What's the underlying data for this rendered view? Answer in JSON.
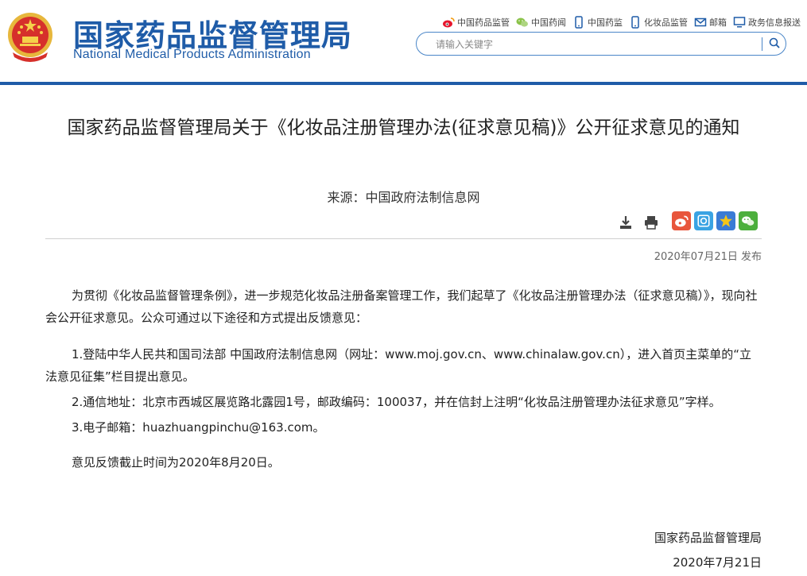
{
  "header": {
    "title_cn": "国家药品监督管理局",
    "title_en": "National Medical Products Administration",
    "emblem_icon": "national-emblem-icon",
    "links": [
      {
        "label": "中国药品监管",
        "icon": "weibo-icon"
      },
      {
        "label": "中国药闻",
        "icon": "wechat-icon"
      },
      {
        "label": "中国药监",
        "icon": "mobile-icon"
      },
      {
        "label": "化妆品监管",
        "icon": "mobile-icon"
      },
      {
        "label": "邮箱",
        "icon": "mail-icon"
      },
      {
        "label": "政务信息报送",
        "icon": "monitor-icon"
      }
    ],
    "search": {
      "placeholder": "请输入关键字",
      "value": "",
      "icon": "search-icon"
    }
  },
  "article": {
    "title": "国家药品监督管理局关于《化妆品注册管理办法(征求意见稿)》公开征求意见的通知",
    "source": "来源：中国政府法制信息网",
    "tools": [
      {
        "icon": "download-icon"
      },
      {
        "icon": "print-icon"
      }
    ],
    "share": [
      {
        "icon": "weibo-share-icon",
        "color": "#e8563c"
      },
      {
        "icon": "qq-zone-share-icon",
        "color": "#3aa3e3"
      },
      {
        "icon": "star-share-icon",
        "color": "#3a7bd5"
      },
      {
        "icon": "wechat-share-icon",
        "color": "#4caf3c"
      }
    ],
    "pubdate": "2020年07月21日 发布",
    "paragraphs": [
      "为贯彻《化妆品监督管理条例》，进一步规范化妆品注册备案管理工作，我们起草了《化妆品注册管理办法（征求意见稿）》，现向社会公开征求意见。公众可通过以下途径和方式提出反馈意见：",
      "1.登陆中华人民共和国司法部 中国政府法制信息网（网址：www.moj.gov.cn、www.chinalaw.gov.cn），进入首页主菜单的“立法意见征集”栏目提出意见。",
      "2.通信地址：北京市西城区展览路北露园1号，邮政编码：100037，并在信封上注明“化妆品注册管理办法征求意见”字样。",
      "3.电子邮箱：huazhuangpinchu@163.com。",
      "意见反馈截止时间为2020年8月20日。"
    ],
    "signature": "国家药品监督管理局",
    "sign_date": "2020年7月21日"
  },
  "colors": {
    "brand_blue": "#1f5ca8",
    "search_border": "#4a86c8"
  }
}
